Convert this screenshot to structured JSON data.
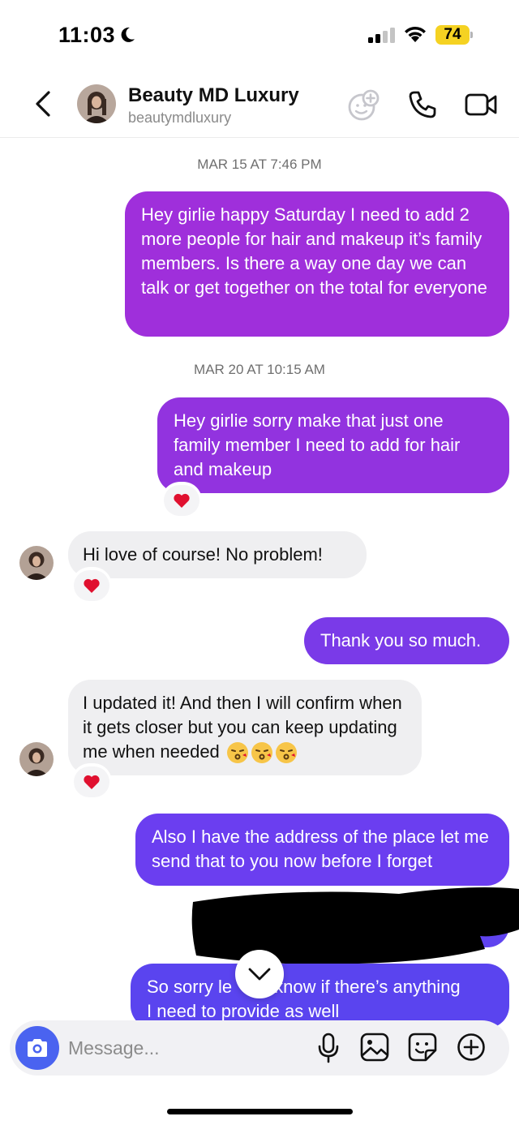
{
  "status_bar": {
    "time": "11:03",
    "battery": "74"
  },
  "header": {
    "name": "Beauty MD Luxury",
    "handle": "beautymdluxury"
  },
  "colors": {
    "accent": "#4a63f0",
    "bubble_purple": "#9d2fdc",
    "bubble_violet": "#7a3ee8",
    "reaction": "#e0102f"
  },
  "messages": {
    "stamp1": "MAR 15 AT 7:46 PM",
    "m1": "Hey girlie happy Saturday I need to add 2 more people for hair and makeup it’s family members.  Is there a way one day we can talk or get together on the total for everyone",
    "stamp2": "MAR 20 AT 10:15 AM",
    "m2": "Hey girlie sorry make that just one family member I need to add for hair and makeup",
    "m3": "Hi love  of course! No problem!",
    "m4": "Thank you so much.",
    "m5": "I updated it! And then I will confirm when it gets closer but you can keep updating me when needed",
    "m6": "Also I have the address of the place let me send that to you now before I forget",
    "m8_left": "So sorry le",
    "m8_right": "know if there’s anything",
    "m8_line2": "I need to provide as well"
  },
  "composer": {
    "placeholder": "Message..."
  }
}
